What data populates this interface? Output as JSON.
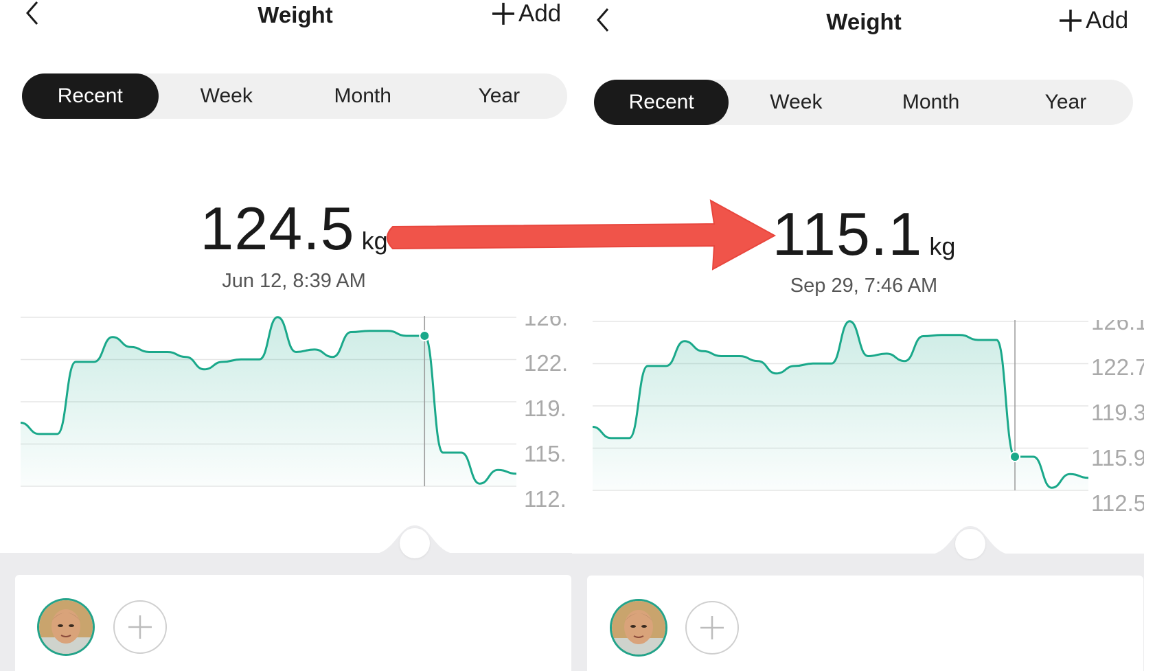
{
  "colors": {
    "accent": "#1aa88a",
    "active_tab_bg": "#1a1a1a",
    "tab_bg": "#f0f0f0",
    "annotation_arrow": "#f0544a"
  },
  "icons": {
    "back": "back-chevron-icon",
    "add": "plus-icon",
    "add_user": "plus-circle-icon"
  },
  "left_screen": {
    "header": {
      "title": "Weight",
      "add_label": "Add"
    },
    "tabs": [
      {
        "label": "Recent",
        "active": true
      },
      {
        "label": "Week",
        "active": false
      },
      {
        "label": "Month",
        "active": false
      },
      {
        "label": "Year",
        "active": false
      }
    ],
    "reading": {
      "value": "124.5",
      "unit": "kg",
      "date": "Jun 12, 8:39 AM"
    },
    "chart_axis_labels": [
      "126.",
      "122.",
      "119.",
      "115.",
      "112."
    ]
  },
  "right_screen": {
    "header": {
      "title": "Weight",
      "add_label": "Add"
    },
    "tabs": [
      {
        "label": "Recent",
        "active": true
      },
      {
        "label": "Week",
        "active": false
      },
      {
        "label": "Month",
        "active": false
      },
      {
        "label": "Year",
        "active": false
      }
    ],
    "reading": {
      "value": "115.1",
      "unit": "kg",
      "date": "Sep 29, 7:46 AM"
    },
    "chart_axis_labels": [
      "126.1",
      "122.7",
      "119.3",
      "115.9",
      "112.5"
    ]
  },
  "chart_data": {
    "type": "area",
    "y_ticks": [
      126.1,
      122.7,
      119.3,
      115.9,
      112.5
    ],
    "ylim": [
      112.5,
      126.1
    ],
    "grid": true,
    "series": [
      {
        "values": [
          117.5,
          116.6,
          116.6,
          122.4,
          122.4,
          124.4,
          123.6,
          123.2,
          123.2,
          122.8,
          121.8,
          122.4,
          122.6,
          122.6,
          126.0,
          123.2,
          123.4,
          122.8,
          124.8,
          124.9,
          124.9,
          124.5,
          124.5,
          115.1,
          115.1,
          112.6,
          113.7,
          113.4
        ]
      }
    ],
    "highlighted_points": [
      {
        "index": 22,
        "value": 124.5,
        "label": "Jun 12, 8:39 AM"
      },
      {
        "index": 23,
        "value": 115.1,
        "label": "Sep 29, 7:46 AM"
      }
    ]
  }
}
